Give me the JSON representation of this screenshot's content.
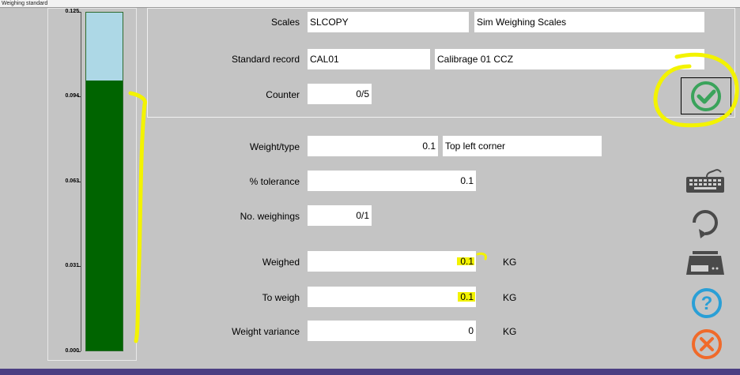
{
  "window": {
    "title": "Weighing standard"
  },
  "gauge": {
    "ticks": [
      "0.125",
      "0.094",
      "0.063",
      "0.031",
      "0.000"
    ],
    "max": 0.125,
    "value": 0.1,
    "fill_color": "#006400",
    "empty_color": "#add8e6"
  },
  "form": {
    "scales": {
      "label": "Scales",
      "code": "SLCOPY",
      "name": "Sim Weighing Scales"
    },
    "standard_record": {
      "label": "Standard record",
      "code": "CAL01",
      "name": "Calibrage 01 CCZ"
    },
    "counter": {
      "label": "Counter",
      "value": "0/5"
    },
    "weight_type": {
      "label": "Weight/type",
      "value": "0.1",
      "type": "Top left corner"
    },
    "tolerance": {
      "label": "% tolerance",
      "value": "0.1"
    },
    "weighings": {
      "label": "No. weighings",
      "value": "0/1"
    },
    "weighed": {
      "label": "Weighed",
      "value": "0.1",
      "unit": "KG"
    },
    "to_weigh": {
      "label": "To weigh",
      "value": "0.1",
      "unit": "KG"
    },
    "variance": {
      "label": "Weight variance",
      "value": "0",
      "unit": "KG"
    }
  },
  "buttons": {
    "validate": "check-icon",
    "keyboard": "keyboard-icon",
    "refresh": "refresh-icon",
    "scale": "scale-icon",
    "help": "help-icon",
    "cancel": "cancel-icon"
  },
  "colors": {
    "accent_green": "#3aa35b",
    "help_blue": "#2a9fd6",
    "cancel_orange": "#f06a2a",
    "highlight_yellow": "#f3f300",
    "bottom_bar": "#4b3f82"
  }
}
